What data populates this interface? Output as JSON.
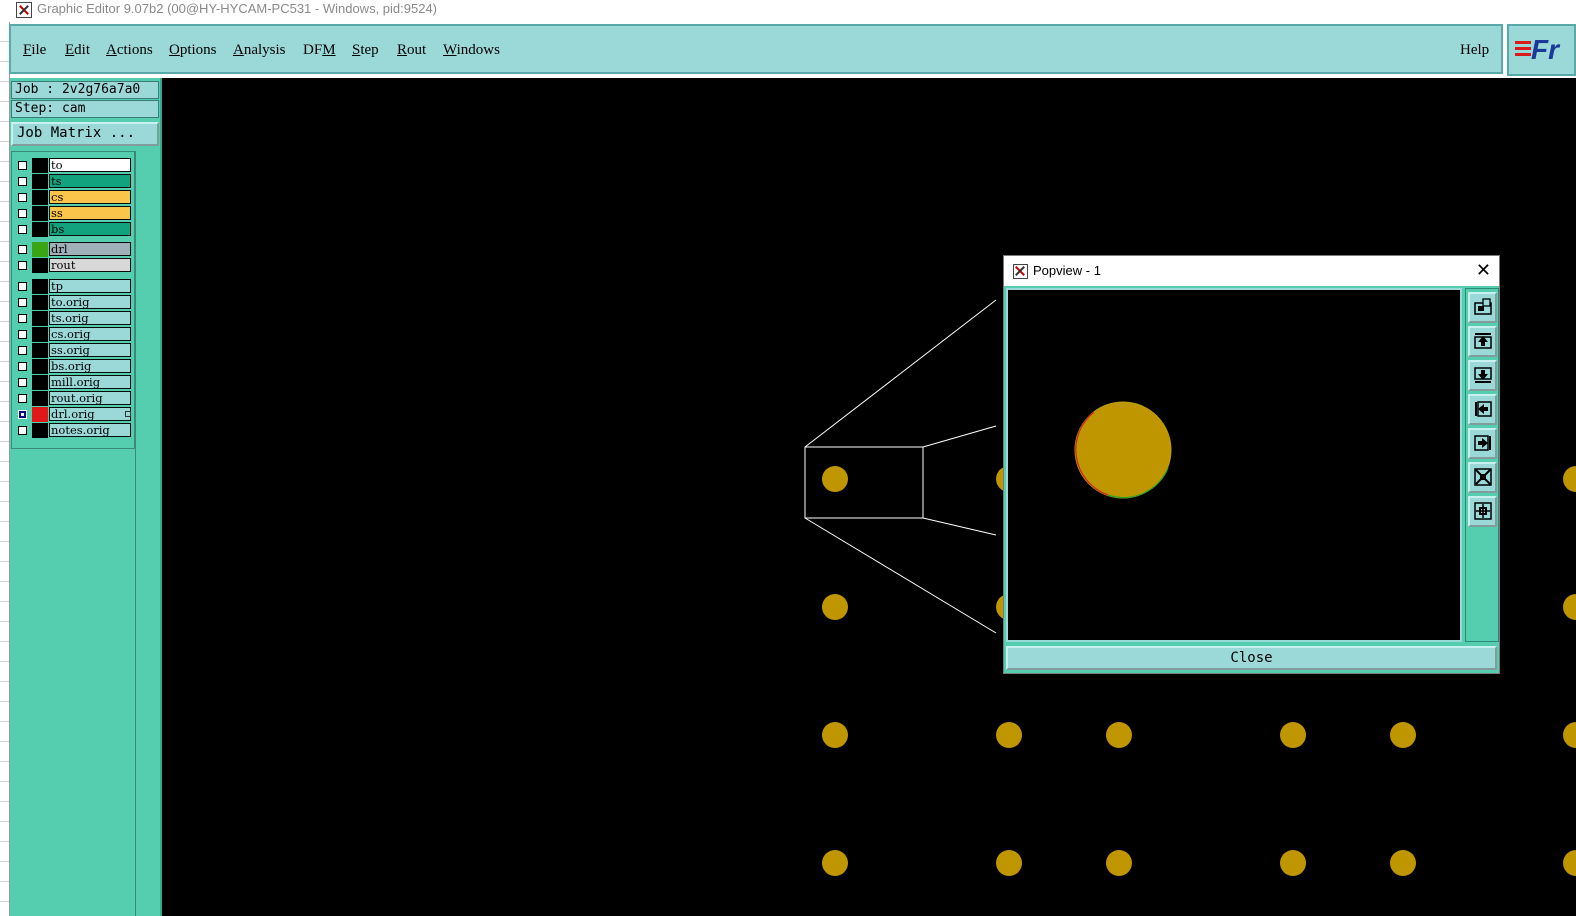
{
  "window": {
    "title": "Graphic Editor 9.07b2 (00@HY-HYCAM-PC531 - Windows, pid:9524)"
  },
  "menubar": {
    "items": [
      {
        "pre": "",
        "u": "F",
        "post": "ile"
      },
      {
        "pre": "",
        "u": "E",
        "post": "dit"
      },
      {
        "pre": "",
        "u": "A",
        "post": "ctions"
      },
      {
        "pre": "",
        "u": "O",
        "post": "ptions"
      },
      {
        "pre": "",
        "u": "A",
        "post": "nalysis"
      },
      {
        "pre": "DF",
        "u": "M",
        "post": ""
      },
      {
        "pre": "",
        "u": "S",
        "post": "tep"
      },
      {
        "pre": "",
        "u": "R",
        "post": "out"
      },
      {
        "pre": "",
        "u": "W",
        "post": "indows"
      }
    ],
    "help": "Help",
    "logo_text": "Fr"
  },
  "sidebar": {
    "job": "Job : 2v2g76a7a0",
    "step": "Step: cam",
    "job_matrix": "Job Matrix ...",
    "layers": [
      {
        "name": "to",
        "bg": "#ffffff",
        "swatch": "#000000",
        "checked": false
      },
      {
        "name": "ts",
        "bg": "#12a37e",
        "swatch": "#000000",
        "checked": false
      },
      {
        "name": "cs",
        "bg": "#fbc44a",
        "swatch": "#000000",
        "checked": false
      },
      {
        "name": "ss",
        "bg": "#fbc44a",
        "swatch": "#000000",
        "checked": false
      },
      {
        "name": "bs",
        "bg": "#12a37e",
        "swatch": "#000000",
        "checked": false
      },
      {
        "name": "drl",
        "bg": "#a0b0b8",
        "swatch": "#3aa514",
        "checked": false
      },
      {
        "name": "rout",
        "bg": "#d8d8d8",
        "swatch": "#000000",
        "checked": false
      },
      {
        "name": "tp",
        "bg": "#9bd8d8",
        "swatch": "#000000",
        "checked": false
      },
      {
        "name": "to.orig",
        "bg": "#9bd8d8",
        "swatch": "#000000",
        "checked": false
      },
      {
        "name": "ts.orig",
        "bg": "#9bd8d8",
        "swatch": "#000000",
        "checked": false
      },
      {
        "name": "cs.orig",
        "bg": "#9bd8d8",
        "swatch": "#000000",
        "checked": false
      },
      {
        "name": "ss.orig",
        "bg": "#9bd8d8",
        "swatch": "#000000",
        "checked": false
      },
      {
        "name": "bs.orig",
        "bg": "#9bd8d8",
        "swatch": "#000000",
        "checked": false
      },
      {
        "name": "mill.orig",
        "bg": "#9bd8d8",
        "swatch": "#000000",
        "checked": false
      },
      {
        "name": "rout.orig",
        "bg": "#9bd8d8",
        "swatch": "#000000",
        "checked": false
      },
      {
        "name": "drl.orig",
        "bg": "#9bd8d8",
        "swatch": "#e01818",
        "checked": true
      },
      {
        "name": "notes.orig",
        "bg": "#9bd8d8",
        "swatch": "#000000",
        "checked": false
      }
    ]
  },
  "popview": {
    "title": "Popview - 1",
    "close_label": "Close",
    "tools": [
      "zoom-window-icon",
      "pan-up-icon",
      "pan-down-icon",
      "pan-left-icon",
      "pan-right-icon",
      "zoom-fit-icon",
      "zoom-center-icon"
    ]
  },
  "colors": {
    "pad": "#c09600",
    "canvas": "#000000",
    "panel": "#55ceb0",
    "menubar": "#9bd8d8"
  }
}
